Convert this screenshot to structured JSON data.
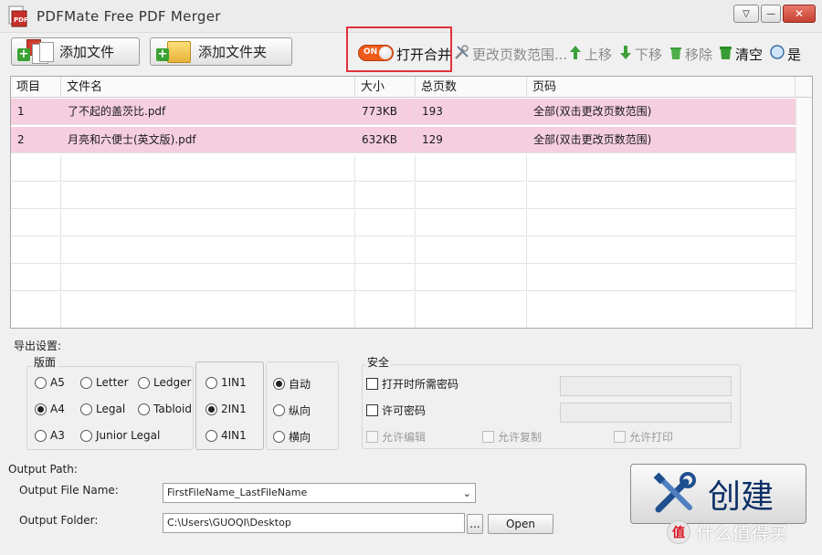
{
  "window": {
    "title": "PDFMate Free PDF Merger",
    "dropdown_glyph": "▽",
    "minimize_glyph": "—",
    "close_glyph": "✕"
  },
  "toolbar": {
    "add_file_label": "添加文件",
    "add_folder_label": "添加文件夹",
    "merge_toggle_state": "ON",
    "merge_label": "打开合并",
    "change_page_range_label": "更改页数范围...",
    "move_up_label": "上移",
    "move_down_label": "下移",
    "remove_label": "移除",
    "clear_label": "清空",
    "yes_label": "是"
  },
  "table": {
    "columns": [
      "项目",
      "文件名",
      "大小",
      "总页数",
      "页码"
    ],
    "rows": [
      {
        "index": "1",
        "name": "了不起的盖茨比.pdf",
        "size": "773KB",
        "pages": "193",
        "range": "全部(双击更改页数范围)"
      },
      {
        "index": "2",
        "name": "月亮和六便士(英文版).pdf",
        "size": "632KB",
        "pages": "129",
        "range": "全部(双击更改页数范围)"
      }
    ]
  },
  "output_settings": {
    "title": "导出设置:",
    "layout_legend": "版面",
    "layout_options": [
      "A5",
      "Letter",
      "Ledger",
      "A4",
      "Legal",
      "Tabloid",
      "A3",
      "Junior Legal"
    ],
    "layout_selected": "A4",
    "nup_options": [
      "1IN1",
      "2IN1",
      "4IN1"
    ],
    "nup_selected": "2IN1",
    "orientation_options": [
      "自动",
      "纵向",
      "横向"
    ],
    "orientation_selected": "自动"
  },
  "security": {
    "legend": "安全",
    "open_password_label": "打开时所需密码",
    "permission_password_label": "许可密码",
    "allow_edit_label": "允许编辑",
    "allow_copy_label": "允许复制",
    "allow_print_label": "允许打印"
  },
  "output": {
    "path_label": "Output Path:",
    "file_name_label": "Output File Name:",
    "file_name_value": "FirstFileName_LastFileName",
    "folder_label": "Output Folder:",
    "folder_value": "C:\\Users\\GUOQI\\Desktop",
    "browse_label": "...",
    "open_label": "Open",
    "create_label": "创建"
  },
  "watermark": {
    "badge": "值",
    "text": "什么值得买"
  },
  "colors": {
    "selected_row": "#f5cfe0",
    "toggle_on": "#ee5a18",
    "highlight": "#e0323b",
    "create_text": "#0c2f66"
  }
}
